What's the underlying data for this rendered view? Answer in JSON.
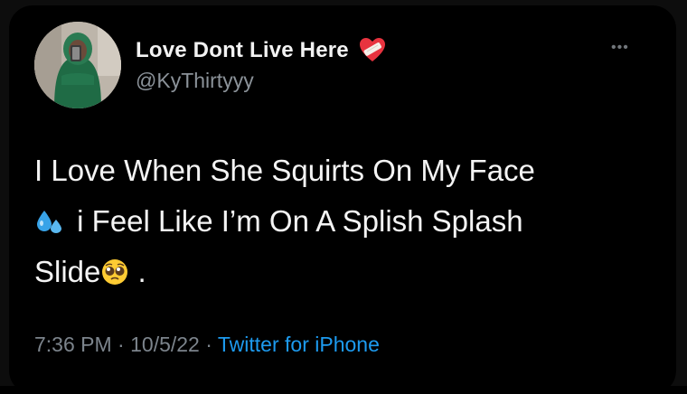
{
  "tweet": {
    "author": {
      "display_name": "Love Dont Live Here",
      "name_emoji": "mending-heart-emoji",
      "handle": "@KyThirtyyy"
    },
    "more_icon": "more-options-icon",
    "text": {
      "line1": "I Love When She Squirts On My Face",
      "line2": "i Feel Like I’m On A Splish Splash",
      "line3_word": "Slide",
      "line3_end": " ."
    },
    "emojis": [
      "sweat-droplets-emoji",
      "pleading-face-emoji"
    ],
    "meta": {
      "time": "7:36 PM",
      "separator": " · ",
      "date": "10/5/22",
      "source": "Twitter for iPhone"
    }
  },
  "colors": {
    "background": "#000000",
    "text": "#f4f4f4",
    "secondary": "#7c848c",
    "link": "#1d9bf0"
  }
}
